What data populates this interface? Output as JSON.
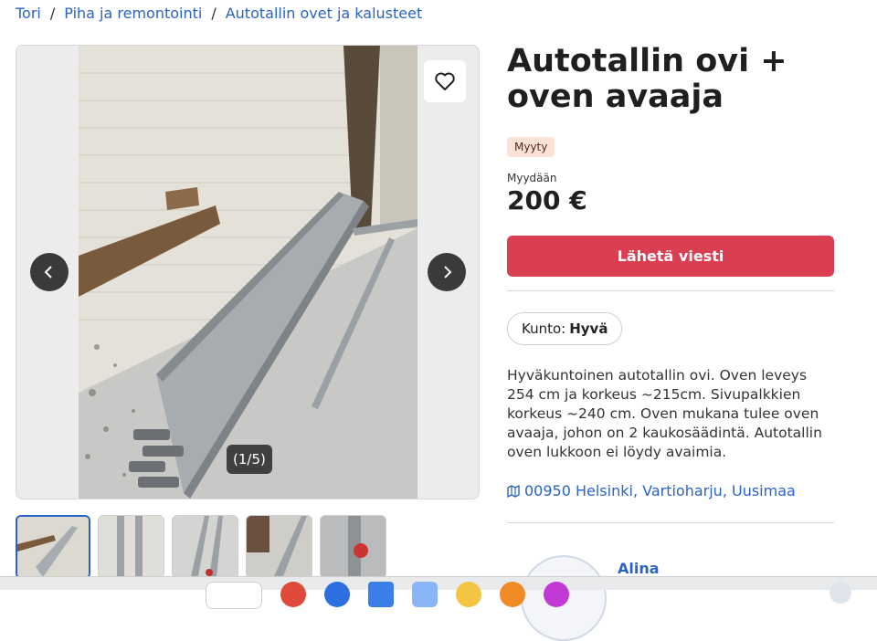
{
  "breadcrumb": {
    "items": [
      "Tori",
      "Piha ja remontointi",
      "Autotallin ovet ja kalusteet"
    ],
    "separator": "/"
  },
  "gallery": {
    "counter": "(1/5)",
    "thumbnail_count": 5
  },
  "listing": {
    "title": "Autotallin ovi + oven avaaja",
    "status_badge": "Myyty",
    "price_label": "Myydään",
    "price": "200 €",
    "send_button": "Lähetä viesti",
    "condition_label": "Kunto:",
    "condition_value": "Hyvä",
    "description": "Hyväkuntoinen autotallin ovi. Oven leveys 254 cm ja korkeus ~215cm. Sivupalkkien korkeus ~240 cm. Oven mukana tulee oven avaaja, johon on 2 kaukosäädintä. Autotallin oven lukkoon ei löydy avaimia.",
    "location": "00950 Helsinki, Vartioharju, Uusimaa"
  },
  "seller": {
    "name": "Alina"
  },
  "colors": {
    "link": "#2b63c6",
    "primary_button": "#d93f51",
    "badge_bg": "#fde3d7"
  },
  "icons": {
    "favorite": "heart-icon",
    "previous": "chevron-left-icon",
    "next": "chevron-right-icon",
    "location": "map-icon"
  }
}
